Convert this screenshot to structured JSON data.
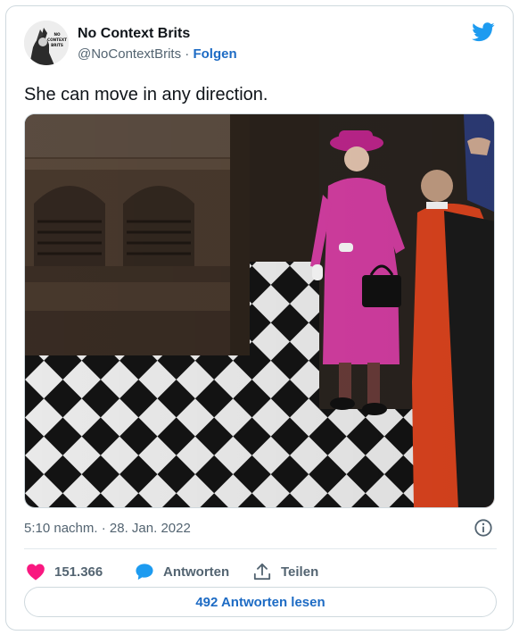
{
  "author": {
    "display_name": "No Context Brits",
    "handle": "@NoContextBrits",
    "separator": "·",
    "follow_label": "Folgen",
    "avatar_text": "NO CONTEXT BRITS"
  },
  "tweet": {
    "text": "She can move in any direction.",
    "image_alt": "Woman in pink coat standing on a black and white checkered floor"
  },
  "meta": {
    "time": "5:10 nachm.",
    "separator": "·",
    "date": "28. Jan. 2022"
  },
  "actions": {
    "likes_count": "151.366",
    "reply_label": "Antworten",
    "share_label": "Teilen"
  },
  "read_replies_label": "492 Antworten lesen",
  "colors": {
    "brand_blue": "#1d9bf0",
    "link_blue": "#1d6bc4",
    "like_pink": "#f91880",
    "text_secondary": "#536471"
  },
  "icons": {
    "bird": "twitter-bird-icon",
    "info": "info-icon",
    "heart": "heart-icon",
    "reply": "reply-bubble-icon",
    "share": "share-icon"
  }
}
